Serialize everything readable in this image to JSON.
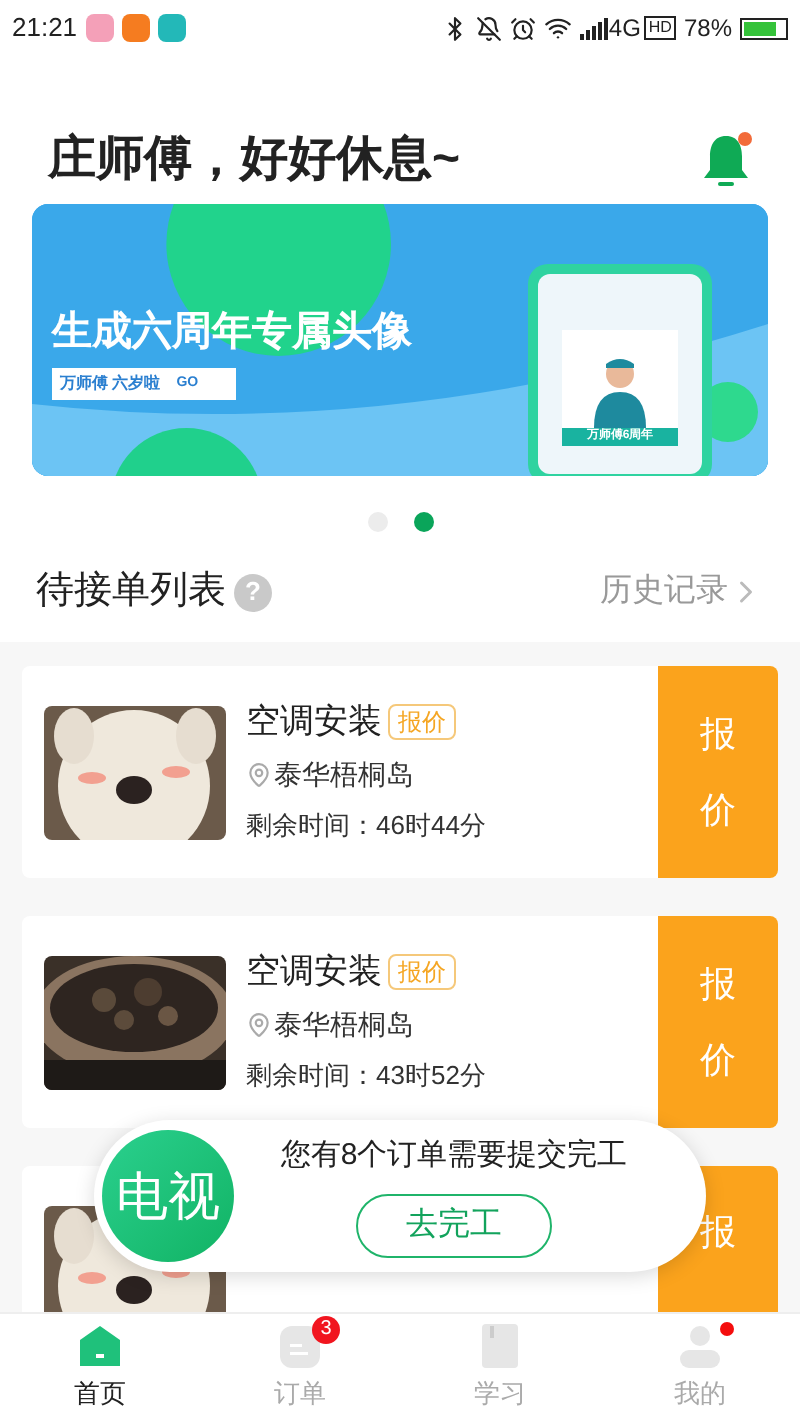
{
  "status_bar": {
    "time": "21:21",
    "network": "4G",
    "hd": "HD",
    "battery": "78%"
  },
  "header": {
    "greeting": "庄师傅，好好休息~",
    "bell_dot": true
  },
  "banner": {
    "headline": "生成六周年专属头像",
    "tag": "万师傅 六岁啦",
    "go": "GO",
    "phone_caption": "万师傅6周年"
  },
  "carousel_dots": [
    {
      "selected": false
    },
    {
      "selected": true
    }
  ],
  "section": {
    "title": "待接单列表",
    "help": "?",
    "history": "历史记录"
  },
  "orders": [
    {
      "title": "空调安装",
      "tag": "报价",
      "location": "泰华梧桐岛",
      "remaining": "剩余时间：46时44分",
      "action": "报价"
    },
    {
      "title": "空调安装",
      "tag": "报价",
      "location": "泰华梧桐岛",
      "remaining": "剩余时间：43时52分",
      "action": "报价"
    },
    {
      "action": "报"
    }
  ],
  "popup": {
    "avatar": "电视",
    "message": "您有8个订单需要提交完工",
    "button": "去完工"
  },
  "tabs": [
    {
      "label": "首页",
      "selected": true,
      "kind": "home"
    },
    {
      "label": "订单",
      "selected": false,
      "kind": "orders",
      "badge": "3"
    },
    {
      "label": "学习",
      "selected": false,
      "kind": "study"
    },
    {
      "label": "我的",
      "selected": false,
      "kind": "profile",
      "dot": true
    }
  ]
}
